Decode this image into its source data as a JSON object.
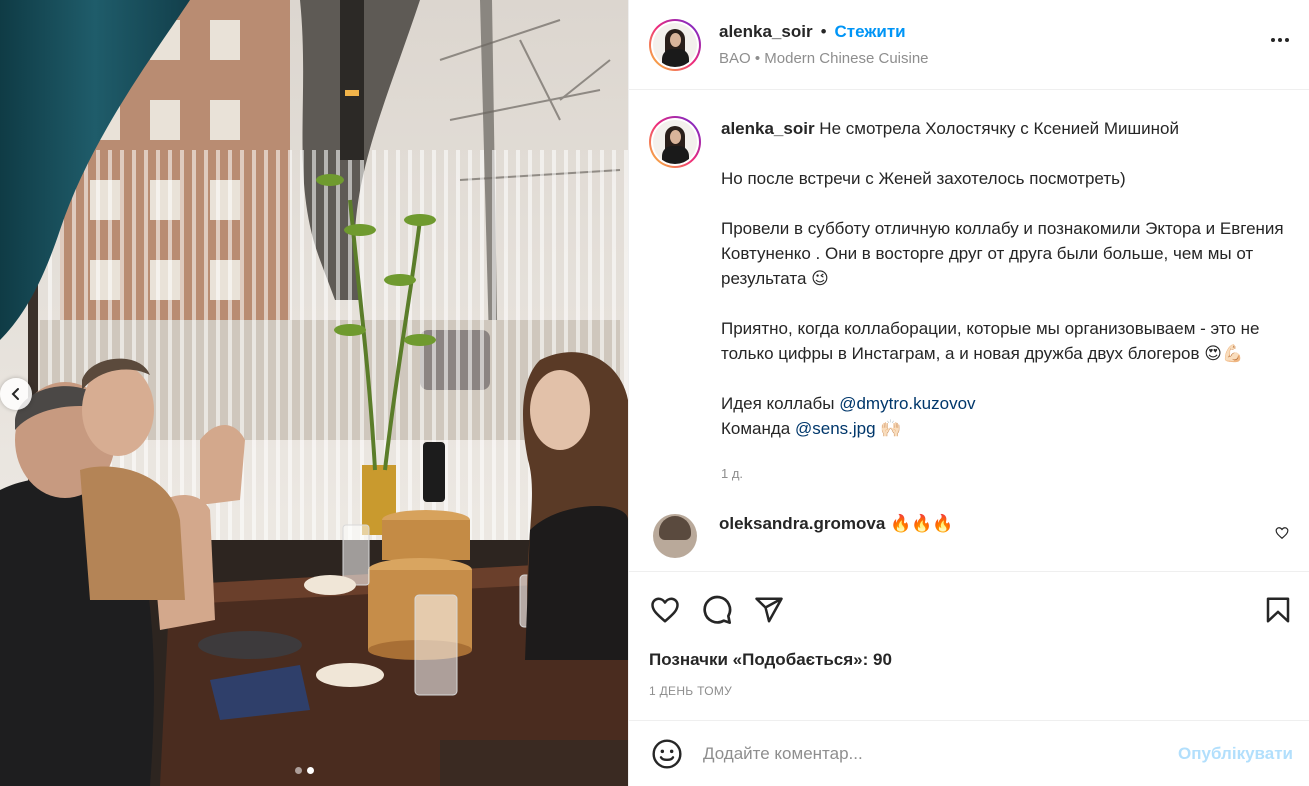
{
  "post": {
    "username": "alenka_soir",
    "separator": "•",
    "follow_label": "Стежити",
    "location": "BAO • Modern Chinese Cuisine"
  },
  "caption": {
    "username": "alenka_soir",
    "line1": "Не смотрела Холостячку с Ксенией Мишиной",
    "para2": "Но после встречи с Женей захотелось посмотреть)",
    "para3": "Провели в субботу отличную коллабу и познакомили Эктора и Евгения Ковтуненко . Они в восторге друг от друга были больше, чем мы от результата 😉",
    "para4": "Приятно, когда коллаборации, которые мы организовываем - это не только цифры в Инстаграм, а и новая дружба двух блогеров 😍💪🏻",
    "idea_label": "Идея коллабы",
    "idea_mention": "@dmytro.kuzovov",
    "team_label": "Команда",
    "team_mention": "@sens.jpg",
    "team_emoji": "🙌🏻",
    "time": "1 д."
  },
  "comment": {
    "username": "oleksandra.gromova",
    "text": "🔥🔥🔥"
  },
  "actions": {
    "likes": "Позначки «Подобається»: 90",
    "date": "1 ДЕНЬ ТОМУ"
  },
  "add_comment": {
    "placeholder": "Додайте коментар...",
    "publish_label": "Опублікувати"
  },
  "carousel": {
    "slide_count": 2,
    "active_index": 1
  },
  "colors": {
    "accent": "#0095f6",
    "link": "#00376b",
    "muted": "#8e8e8e",
    "publish_disabled": "#b2dffc"
  },
  "icons": [
    "more-icon",
    "heart-icon",
    "comment-icon",
    "share-icon",
    "bookmark-icon",
    "emoji-icon",
    "chevron-left-icon"
  ]
}
